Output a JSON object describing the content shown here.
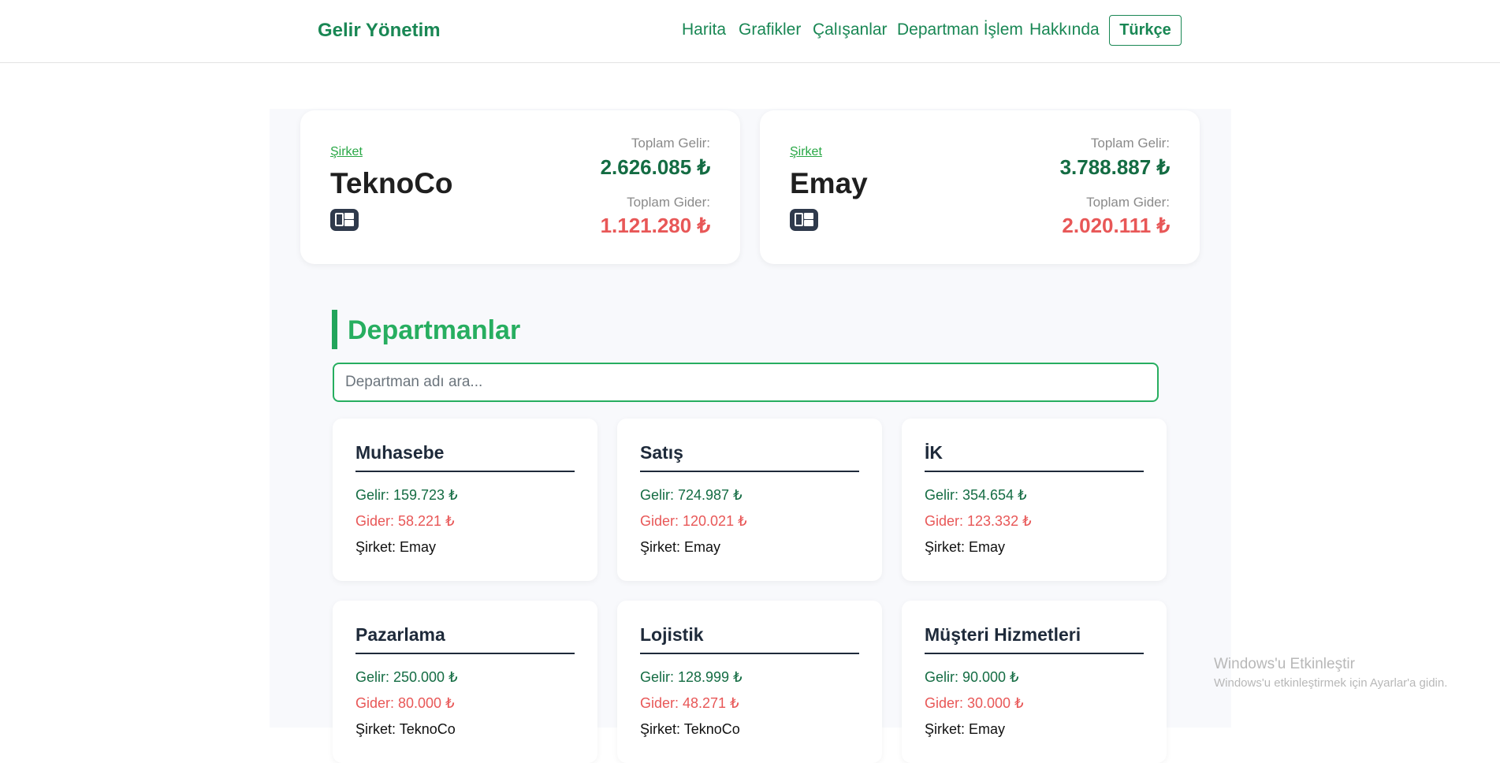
{
  "app": {
    "brand": "Gelir Yönetim"
  },
  "nav": {
    "items": [
      "Harita",
      "Grafikler",
      "Çalışanlar",
      "Departman İşlem",
      "Hakkında"
    ],
    "language": "Türkçe"
  },
  "companies": [
    {
      "kicker": "Şirket",
      "name": "TeknoCo",
      "income_label": "Toplam Gelir:",
      "income": "2.626.085 ₺",
      "expense_label": "Toplam Gider:",
      "expense": "1.121.280 ₺"
    },
    {
      "kicker": "Şirket",
      "name": "Emay",
      "income_label": "Toplam Gelir:",
      "income": "3.788.887 ₺",
      "expense_label": "Toplam Gider:",
      "expense": "2.020.111 ₺"
    }
  ],
  "departments_section": {
    "title": "Departmanlar",
    "search_placeholder": "Departman adı ara..."
  },
  "departments": [
    {
      "name": "Muhasebe",
      "income": "Gelir: 159.723 ₺",
      "expense": "Gider: 58.221 ₺",
      "company": "Şirket: Emay"
    },
    {
      "name": "Satış",
      "income": "Gelir: 724.987 ₺",
      "expense": "Gider: 120.021 ₺",
      "company": "Şirket: Emay"
    },
    {
      "name": "İK",
      "income": "Gelir: 354.654 ₺",
      "expense": "Gider: 123.332 ₺",
      "company": "Şirket: Emay"
    },
    {
      "name": "Pazarlama",
      "income": "Gelir: 250.000 ₺",
      "expense": "Gider: 80.000 ₺",
      "company": "Şirket: TeknoCo"
    },
    {
      "name": "Lojistik",
      "income": "Gelir: 128.999 ₺",
      "expense": "Gider: 48.271 ₺",
      "company": "Şirket: TeknoCo"
    },
    {
      "name": "Müşteri Hizmetleri",
      "income": "Gelir: 90.000 ₺",
      "expense": "Gider: 30.000 ₺",
      "company": "Şirket: Emay"
    }
  ],
  "watermark": {
    "line1": "Windows'u Etkinleştir",
    "line2": "Windows'u etkinleştirmek için Ayarlar'a gidin."
  },
  "colors": {
    "brand_green": "#198754",
    "income_green": "#146c43",
    "expense_red": "#e85757",
    "heading_dark": "#1e2a3a",
    "section_green": "#27ae60"
  }
}
